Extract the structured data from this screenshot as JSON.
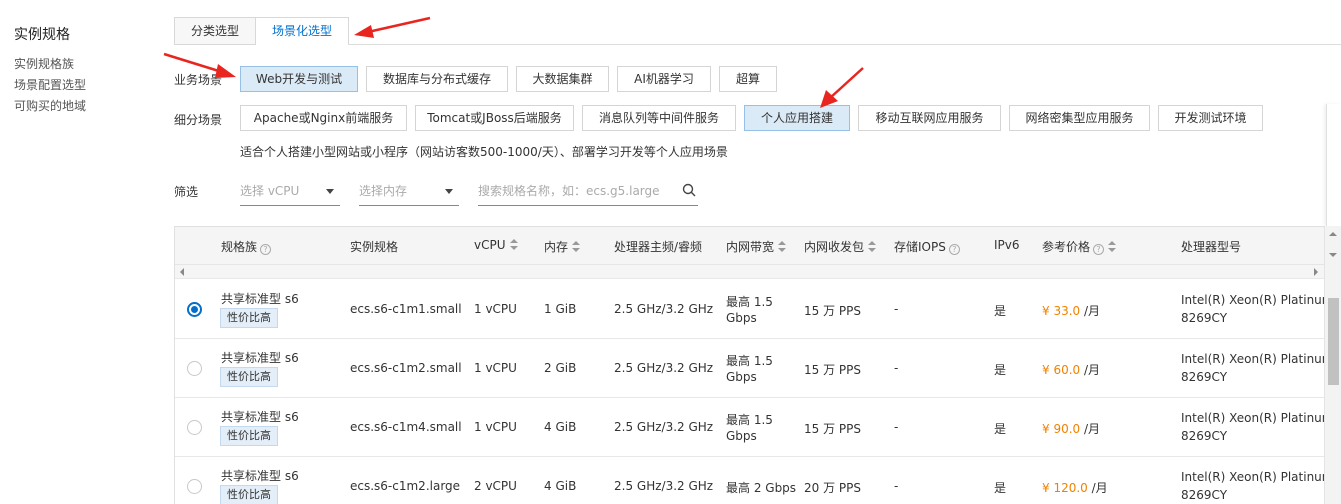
{
  "left_nav": {
    "title": "实例规格",
    "items": [
      "实例规格族",
      "场景配置选型",
      "可购买的地域"
    ]
  },
  "tabs": [
    {
      "label": "分类选型",
      "active": false
    },
    {
      "label": "场景化选型",
      "active": true
    }
  ],
  "business_scenario": {
    "label": "业务场景",
    "options": [
      {
        "label": "Web开发与测试",
        "active": true
      },
      {
        "label": "数据库与分布式缓存",
        "active": false
      },
      {
        "label": "大数据集群",
        "active": false
      },
      {
        "label": "AI机器学习",
        "active": false
      },
      {
        "label": "超算",
        "active": false
      }
    ]
  },
  "sub_scenario": {
    "label": "细分场景",
    "options": [
      {
        "label": "Apache或Nginx前端服务",
        "active": false
      },
      {
        "label": "Tomcat或JBoss后端服务",
        "active": false
      },
      {
        "label": "消息队列等中间件服务",
        "active": false
      },
      {
        "label": "个人应用搭建",
        "active": true
      },
      {
        "label": "移动互联网应用服务",
        "active": false
      },
      {
        "label": "网络密集型应用服务",
        "active": false
      },
      {
        "label": "开发测试环境",
        "active": false
      }
    ],
    "description": "适合个人搭建小型网站或小程序（网站访客数500-1000/天）、部署学习开发等个人应用场景"
  },
  "filter": {
    "label": "筛选",
    "vcpu_placeholder": "选择 vCPU",
    "memory_placeholder": "选择内存",
    "search_placeholder": "搜索规格名称，如：ecs.g5.large"
  },
  "table": {
    "headers": [
      "规格族",
      "实例规格",
      "vCPU",
      "内存",
      "处理器主频/睿频",
      "内网带宽",
      "内网收发包",
      "存储IOPS",
      "IPv6",
      "参考价格",
      "处理器型号"
    ],
    "rows": [
      {
        "selected": true,
        "family": "共享标准型 s6",
        "tag": "性价比高",
        "spec": "ecs.s6-c1m1.small",
        "vcpu": "1 vCPU",
        "memory": "1 GiB",
        "freq": "2.5 GHz/3.2 GHz",
        "bw1": "最高 1.5",
        "bw2": "Gbps",
        "pps": "15 万 PPS",
        "iops": "-",
        "ipv6": "是",
        "price": "¥ 33.0",
        "price_unit": " /月",
        "cpu1": "Intel(R) Xeon(R) Platinum",
        "cpu2": "8269CY"
      },
      {
        "selected": false,
        "family": "共享标准型 s6",
        "tag": "性价比高",
        "spec": "ecs.s6-c1m2.small",
        "vcpu": "1 vCPU",
        "memory": "2 GiB",
        "freq": "2.5 GHz/3.2 GHz",
        "bw1": "最高 1.5",
        "bw2": "Gbps",
        "pps": "15 万 PPS",
        "iops": "-",
        "ipv6": "是",
        "price": "¥ 60.0",
        "price_unit": " /月",
        "cpu1": "Intel(R) Xeon(R) Platinum",
        "cpu2": "8269CY"
      },
      {
        "selected": false,
        "family": "共享标准型 s6",
        "tag": "性价比高",
        "spec": "ecs.s6-c1m4.small",
        "vcpu": "1 vCPU",
        "memory": "4 GiB",
        "freq": "2.5 GHz/3.2 GHz",
        "bw1": "最高 1.5",
        "bw2": "Gbps",
        "pps": "15 万 PPS",
        "iops": "-",
        "ipv6": "是",
        "price": "¥ 90.0",
        "price_unit": " /月",
        "cpu1": "Intel(R) Xeon(R) Platinum",
        "cpu2": "8269CY"
      },
      {
        "selected": false,
        "family": "共享标准型 s6",
        "tag": "性价比高",
        "spec": "ecs.s6-c1m2.large",
        "vcpu": "2 vCPU",
        "memory": "4 GiB",
        "freq": "2.5 GHz/3.2 GHz",
        "bw1": "最高 2 Gbps",
        "bw2": "",
        "pps": "20 万 PPS",
        "iops": "-",
        "ipv6": "是",
        "price": "¥ 120.0",
        "price_unit": " /月",
        "cpu1": "Intel(R) Xeon(R) Platinum",
        "cpu2": "8269CY"
      }
    ]
  },
  "colors": {
    "accent": "#0070cc",
    "price": "#f08200",
    "annotation_arrow": "#e8261f",
    "active_chip_bg": "#dbeaf7"
  }
}
